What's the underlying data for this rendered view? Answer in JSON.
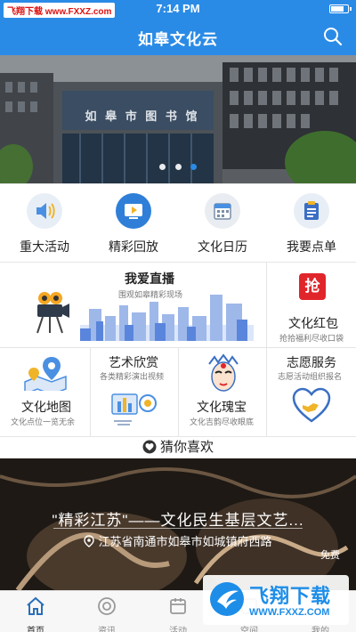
{
  "status_bar": {
    "source": "飞翔下载 www.FXXZ.com",
    "time": "7:14 PM",
    "battery_level": 0.85
  },
  "navbar": {
    "title": "如皋文化云",
    "search_icon": "search-icon"
  },
  "banner": {
    "sign_text": "如 皋 市 图 书 馆",
    "slide_count": 3,
    "active_slide": 3
  },
  "quick_links": [
    {
      "label": "重大活动",
      "icon": "speaker-icon",
      "color": "#4a90e2"
    },
    {
      "label": "精彩回放",
      "icon": "play-screen-icon",
      "color": "#2f7fd8"
    },
    {
      "label": "文化日历",
      "icon": "calendar-icon",
      "color": "#7a8fa8"
    },
    {
      "label": "我要点单",
      "icon": "clipboard-icon",
      "color": "#3a6fc4"
    }
  ],
  "live": {
    "title": "我爱直播",
    "subtitle": "围观如皋精彩现场"
  },
  "red_packet": {
    "title": "文化红包",
    "subtitle": "抢拾福利尽收口袋",
    "badge": "抢"
  },
  "cards": [
    {
      "title": "文化地图",
      "subtitle": "文化点位一览无余"
    },
    {
      "title": "艺术欣赏",
      "subtitle": "各类精彩演出视频"
    },
    {
      "title": "文化瑰宝",
      "subtitle": "文化吉韵尽收眼底"
    },
    {
      "title": "志愿服务",
      "subtitle": "志愿活动组织报名"
    }
  ],
  "guess": {
    "label": "猜你喜欢"
  },
  "feature": {
    "title": "\"精彩江苏\"——文化民生基层文艺...",
    "location": "江苏省南通市如皋市如城镇府西路",
    "price": "免费"
  },
  "tabs": [
    {
      "label": "首页",
      "icon": "home-icon",
      "active": true
    },
    {
      "label": "资讯",
      "icon": "news-icon",
      "active": false
    },
    {
      "label": "活动",
      "icon": "activity-icon",
      "active": false
    },
    {
      "label": "空间",
      "icon": "space-icon",
      "active": false
    },
    {
      "label": "我的",
      "icon": "user-icon",
      "active": false
    }
  ],
  "watermark": {
    "name": "飞翔下载",
    "url": "WWW.FXXZ.COM"
  }
}
